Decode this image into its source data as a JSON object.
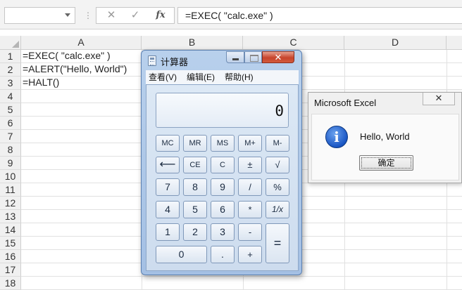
{
  "formula_bar": {
    "name_box": "",
    "cancel_symbol": "✕",
    "enter_symbol": "✓",
    "fx_label": "fx",
    "formula": "=EXEC( \"calc.exe\" )"
  },
  "sheet": {
    "columns": [
      "A",
      "B",
      "C",
      "D"
    ],
    "rows": [
      "1",
      "2",
      "3",
      "4",
      "5",
      "6",
      "7",
      "8",
      "9",
      "10",
      "11",
      "12",
      "13",
      "14",
      "15",
      "16",
      "17",
      "18"
    ],
    "cells": {
      "A1": "=EXEC( \"calc.exe\" )",
      "A2": "=ALERT(\"Hello, World\")",
      "A3": "=HALT()"
    }
  },
  "calculator": {
    "title": "计算器",
    "close_symbol": "✕",
    "menu": [
      "查看(V)",
      "编辑(E)",
      "帮助(H)"
    ],
    "display": "0",
    "keys": {
      "mc": "MC",
      "mr": "MR",
      "ms": "MS",
      "mplus": "M+",
      "mminus": "M-",
      "back": "⟵",
      "ce": "CE",
      "c": "C",
      "plusminus": "±",
      "sqrt": "√",
      "k7": "7",
      "k8": "8",
      "k9": "9",
      "div": "/",
      "pct": "%",
      "k4": "4",
      "k5": "5",
      "k6": "6",
      "mul": "*",
      "recip": "1/x",
      "k1": "1",
      "k2": "2",
      "k3": "3",
      "minus": "-",
      "equals": "=",
      "k0": "0",
      "dot": ".",
      "plus": "+"
    }
  },
  "msgbox": {
    "title": "Microsoft Excel",
    "close_symbol": "✕",
    "icon": "info-icon",
    "icon_glyph": "i",
    "message": "Hello, World",
    "ok_label": "确定"
  }
}
